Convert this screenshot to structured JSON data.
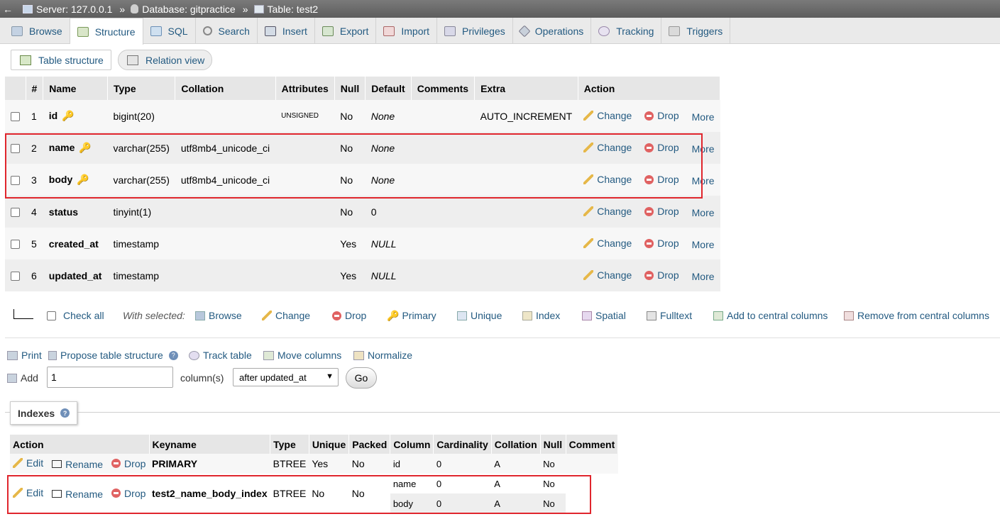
{
  "breadcrumb": {
    "back": "←",
    "server": "Server: 127.0.0.1",
    "database": "Database: gitpractice",
    "table": "Table: test2",
    "sep": "»"
  },
  "tabs": [
    "Browse",
    "Structure",
    "SQL",
    "Search",
    "Insert",
    "Export",
    "Import",
    "Privileges",
    "Operations",
    "Tracking",
    "Triggers"
  ],
  "active_tab": "Structure",
  "subtabs": [
    "Table structure",
    "Relation view"
  ],
  "columns_table": {
    "headers": [
      "#",
      "Name",
      "Type",
      "Collation",
      "Attributes",
      "Null",
      "Default",
      "Comments",
      "Extra",
      "Action"
    ],
    "rows": [
      {
        "num": "1",
        "name": "id",
        "type": "bigint(20)",
        "collation": "",
        "attributes": "UNSIGNED",
        "null": "No",
        "default": "None",
        "comments": "",
        "extra": "AUTO_INCREMENT",
        "key": "primary"
      },
      {
        "num": "2",
        "name": "name",
        "type": "varchar(255)",
        "collation": "utf8mb4_unicode_ci",
        "attributes": "",
        "null": "No",
        "default": "None",
        "comments": "",
        "extra": "",
        "key": "index"
      },
      {
        "num": "3",
        "name": "body",
        "type": "varchar(255)",
        "collation": "utf8mb4_unicode_ci",
        "attributes": "",
        "null": "No",
        "default": "None",
        "comments": "",
        "extra": "",
        "key": "index"
      },
      {
        "num": "4",
        "name": "status",
        "type": "tinyint(1)",
        "collation": "",
        "attributes": "",
        "null": "No",
        "default": "0",
        "comments": "",
        "extra": "",
        "key": "none"
      },
      {
        "num": "5",
        "name": "created_at",
        "type": "timestamp",
        "collation": "",
        "attributes": "",
        "null": "Yes",
        "default": "NULL",
        "comments": "",
        "extra": "",
        "key": "none"
      },
      {
        "num": "6",
        "name": "updated_at",
        "type": "timestamp",
        "collation": "",
        "attributes": "",
        "null": "Yes",
        "default": "NULL",
        "comments": "",
        "extra": "",
        "key": "none"
      }
    ],
    "actions": {
      "change": "Change",
      "drop": "Drop",
      "more": "More"
    }
  },
  "bulk": {
    "check_all": "Check all",
    "with_selected": "With selected:",
    "items": [
      "Browse",
      "Change",
      "Drop",
      "Primary",
      "Unique",
      "Index",
      "Spatial",
      "Fulltext",
      "Add to central columns",
      "Remove from central columns"
    ]
  },
  "links": {
    "print": "Print",
    "propose": "Propose table structure",
    "track": "Track table",
    "move": "Move columns",
    "normalize": "Normalize"
  },
  "add_column": {
    "label": "Add",
    "value": "1",
    "suffix": "column(s)",
    "position": "after updated_at",
    "go": "Go"
  },
  "indexes": {
    "legend": "Indexes",
    "headers": [
      "Action",
      "Keyname",
      "Type",
      "Unique",
      "Packed",
      "Column",
      "Cardinality",
      "Collation",
      "Null",
      "Comment"
    ],
    "actions": {
      "edit": "Edit",
      "rename": "Rename",
      "drop": "Drop"
    },
    "rows": [
      {
        "keyname": "PRIMARY",
        "type": "BTREE",
        "unique": "Yes",
        "packed": "No",
        "columns": [
          {
            "column": "id",
            "cardinality": "0",
            "collation": "A",
            "null": "No"
          }
        ],
        "comment": ""
      },
      {
        "keyname": "test2_name_body_index",
        "type": "BTREE",
        "unique": "No",
        "packed": "No",
        "columns": [
          {
            "column": "name",
            "cardinality": "0",
            "collation": "A",
            "null": "No"
          },
          {
            "column": "body",
            "cardinality": "0",
            "collation": "A",
            "null": "No"
          }
        ],
        "comment": ""
      }
    ]
  },
  "colors": {
    "link": "#235a81",
    "highlight": "#e0262d",
    "header_bg": "#e6e6e6"
  }
}
